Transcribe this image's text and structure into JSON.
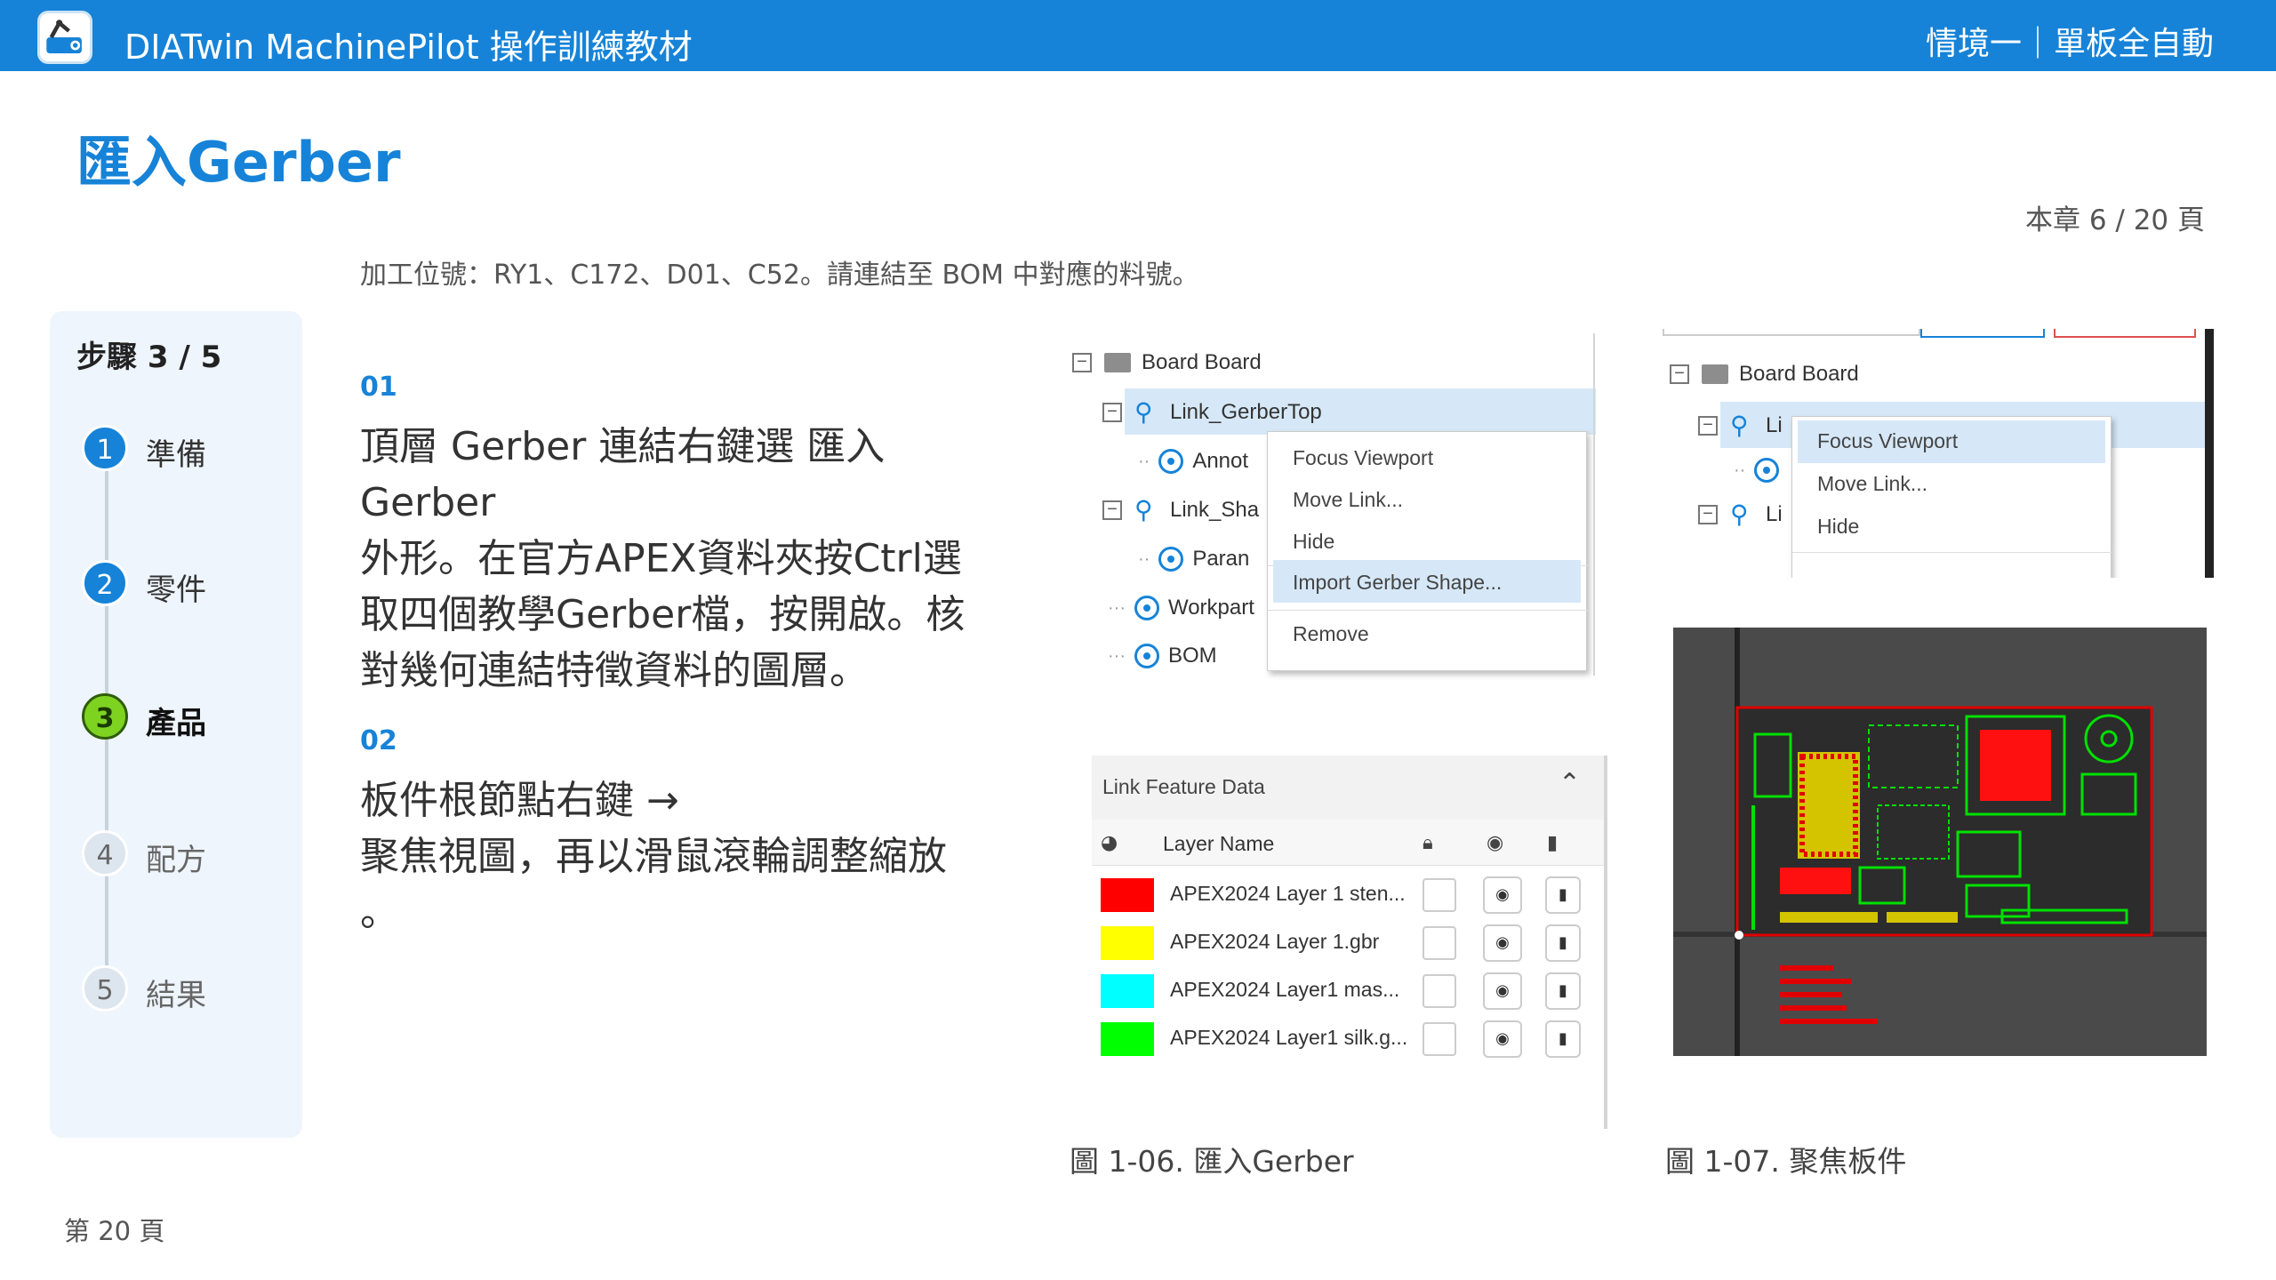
{
  "header": {
    "app_title": "DIATwin MachinePilot 操作訓練教材",
    "scenario": "情境一｜單板全自動"
  },
  "page": {
    "title": "匯入Gerber",
    "chapter_page": "本章 6 / 20 頁",
    "subtitle": "加工位號：RY1、C172、D01、C52。請連結至 BOM 中對應的料號。",
    "page_number": "第 20 頁"
  },
  "steps": {
    "heading": "步驟 3 / 5",
    "items": [
      {
        "num": "1",
        "label": "準備",
        "state": "done"
      },
      {
        "num": "2",
        "label": "零件",
        "state": "done"
      },
      {
        "num": "3",
        "label": "產品",
        "state": "active"
      },
      {
        "num": "4",
        "label": "配方",
        "state": "todo"
      },
      {
        "num": "5",
        "label": "結果",
        "state": "todo"
      }
    ]
  },
  "instructions": [
    {
      "num": "01",
      "lines": [
        "頂層 Gerber 連結右鍵選 匯入",
        "Gerber",
        "外形。在官方APEX資料夾按Ctrl選",
        "取四個教學Gerber檔，按開啟。核",
        "對幾何連結特徵資料的圖層。"
      ]
    },
    {
      "num": "02",
      "lines": [
        "板件根節點右鍵 →",
        "聚焦視圖，再以滑鼠滾輪調整縮放",
        "。"
      ]
    }
  ],
  "tree": {
    "board": "Board  Board",
    "link_top": "Link_GerberTop",
    "annot": "Annot",
    "link_shape": "Link_Sha",
    "param": "Paran",
    "workpart": "Workpart",
    "bom": "BOM"
  },
  "context_menu": {
    "items": [
      "Focus Viewport",
      "Move Link...",
      "Hide",
      "Import Gerber Shape...",
      "Remove"
    ]
  },
  "feature_panel": {
    "title": "Link Feature Data",
    "col_layer": "Layer Name",
    "layers": [
      {
        "name": "APEX2024 Layer 1 sten...",
        "color": "#ff0000"
      },
      {
        "name": "APEX2024 Layer 1.gbr",
        "color": "#ffff00"
      },
      {
        "name": "APEX2024 Layer1 mas...",
        "color": "#00ffff"
      },
      {
        "name": "APEX2024 Layer1 silk.g...",
        "color": "#00ff00"
      }
    ]
  },
  "tree2": {
    "board": "Board  Board",
    "li_a": "Li",
    "li_b": "Li"
  },
  "context_menu2": {
    "items": [
      "Focus Viewport",
      "Move Link...",
      "Hide"
    ]
  },
  "captions": {
    "fig1": "圖 1-06. 匯入Gerber",
    "fig2": "圖 1-07. 聚焦板件"
  },
  "colors": {
    "accent": "#1683d8",
    "step_active": "#7ed321"
  }
}
